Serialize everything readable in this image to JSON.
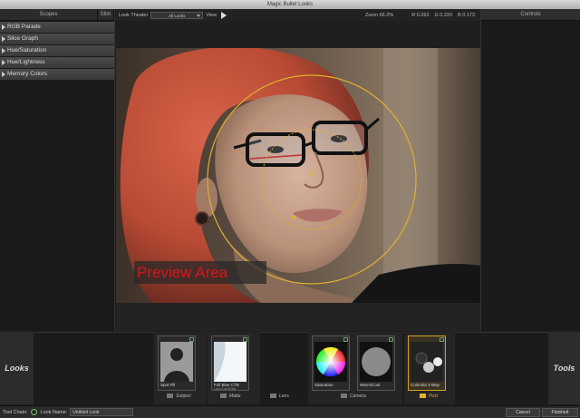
{
  "window": {
    "title": "Magic Bullet Looks"
  },
  "scopes": {
    "tab_label": "Scopes",
    "tab_small_label": "Slim",
    "items": [
      {
        "label": "RGB Parade"
      },
      {
        "label": "Slice Graph"
      },
      {
        "label": "Hue/Saturation"
      },
      {
        "label": "Hue/Lightness"
      },
      {
        "label": "Memory Colors"
      }
    ]
  },
  "toolbar": {
    "look_theater_label": "Look Theater",
    "look_select_value": "All Looks",
    "view_label": "View",
    "zoom_label": "Zoom",
    "zoom_value": "66.2%",
    "r_value": "R 0.263",
    "g_value": "G 0.220",
    "b_value": "B 0.173"
  },
  "controls": {
    "header_label": "Controls"
  },
  "preview": {
    "label": "Preview Area"
  },
  "looks_panel": {
    "left_label": "Looks",
    "right_label": "Tools",
    "tools": [
      {
        "name": "Spot Fill",
        "sub": ""
      },
      {
        "name": "Full Blue CTB",
        "sub": "Lens:ColorFilter"
      },
      {
        "name": "Saturation",
        "sub": ""
      },
      {
        "name": "Warm/Cool",
        "sub": ""
      },
      {
        "name": "Colorista 3-Way",
        "sub": ""
      }
    ],
    "categories": [
      {
        "label": "Subject"
      },
      {
        "label": "Matte"
      },
      {
        "label": "Lens"
      },
      {
        "label": "Camera"
      },
      {
        "label": "Post"
      }
    ]
  },
  "status": {
    "tool_chain_label": "Tool Chain:",
    "look_name_label": "Look Name:",
    "look_name_value": "Untitled Look",
    "cancel_label": "Cancel",
    "finished_label": "Finished"
  },
  "colors": {
    "accent": "#d4a020",
    "preview_label_text": "#e0141a",
    "panel_bg": "#1a1a1a"
  }
}
